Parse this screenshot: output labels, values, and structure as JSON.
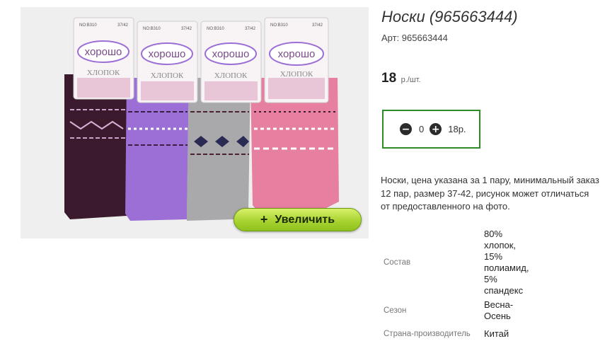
{
  "product": {
    "title": "Носки (965663444)",
    "sku": "Арт: 965663444",
    "price": "18",
    "price_unit": "р./шт.",
    "description": "Носки, цена указана за 1 пару, минимальный заказ 12 пар, размер 37-42, рисунок может отличаться от предоставленного на фото."
  },
  "image": {
    "zoom_button": "Увеличить",
    "tag_brand": "хорошо",
    "tag_material": "ХЛОПОК",
    "tag_code": "NO:B310",
    "tag_size": "37/42",
    "sock_colors": [
      "#3a1a2c",
      "#9b6fd6",
      "#a9a9ab",
      "#e77fa0"
    ]
  },
  "quantity": {
    "value": "0",
    "total": "18р.",
    "minus_icon": "minus-circle-icon",
    "plus_icon": "plus-circle-icon"
  },
  "props": [
    {
      "key": "Состав",
      "value": "80% хлопок, 15% полиамид, 5% спандекс"
    },
    {
      "key": "Сезон",
      "value": "Весна-Осень"
    },
    {
      "key": "Страна-производитель",
      "value": "Китай"
    }
  ],
  "colors": {
    "accent_border": "#2e8b25",
    "zoom_button": "#a9d431"
  }
}
